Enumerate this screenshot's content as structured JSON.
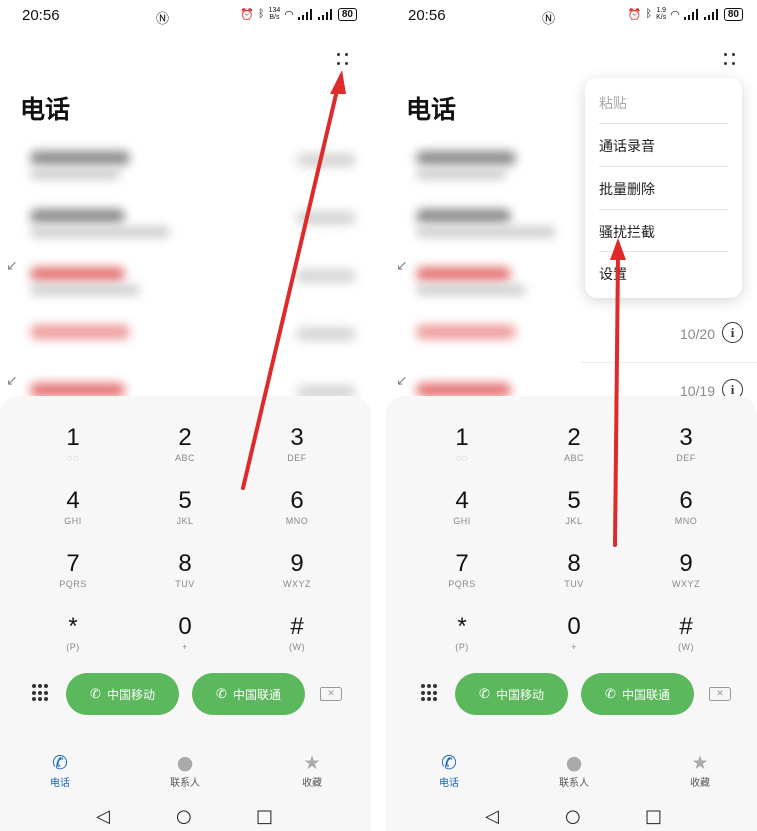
{
  "left": {
    "status": {
      "time": "20:56",
      "net_speed": [
        "134",
        "B/s"
      ],
      "battery": "80"
    },
    "title": "电话",
    "dialpad": {
      "keys": [
        {
          "num": "1",
          "sub": "◌◌"
        },
        {
          "num": "2",
          "sub": "ABC"
        },
        {
          "num": "3",
          "sub": "DEF"
        },
        {
          "num": "4",
          "sub": "GHI"
        },
        {
          "num": "5",
          "sub": "JKL"
        },
        {
          "num": "6",
          "sub": "MNO"
        },
        {
          "num": "7",
          "sub": "PQRS"
        },
        {
          "num": "8",
          "sub": "TUV"
        },
        {
          "num": "9",
          "sub": "WXYZ"
        },
        {
          "num": "*",
          "sub": "(P)"
        },
        {
          "num": "0",
          "sub": "+"
        },
        {
          "num": "#",
          "sub": "(W)"
        }
      ],
      "sim1": "中国移动",
      "sim2": "中国联通"
    },
    "tabs": [
      "电话",
      "联系人",
      "收藏"
    ]
  },
  "right": {
    "status": {
      "time": "20:56",
      "net_speed": [
        "1.9",
        "K/s"
      ],
      "battery": "80"
    },
    "title": "电话",
    "menu": [
      "粘贴",
      "通话录音",
      "批量删除",
      "骚扰拦截",
      "设置"
    ],
    "rows": [
      {
        "date": "10/20"
      },
      {
        "date": "10/19"
      }
    ],
    "dialpad": {
      "keys": [
        {
          "num": "1",
          "sub": "◌◌"
        },
        {
          "num": "2",
          "sub": "ABC"
        },
        {
          "num": "3",
          "sub": "DEF"
        },
        {
          "num": "4",
          "sub": "GHI"
        },
        {
          "num": "5",
          "sub": "JKL"
        },
        {
          "num": "6",
          "sub": "MNO"
        },
        {
          "num": "7",
          "sub": "PQRS"
        },
        {
          "num": "8",
          "sub": "TUV"
        },
        {
          "num": "9",
          "sub": "WXYZ"
        },
        {
          "num": "*",
          "sub": "(P)"
        },
        {
          "num": "0",
          "sub": "+"
        },
        {
          "num": "#",
          "sub": "(W)"
        }
      ],
      "sim1": "中国移动",
      "sim2": "中国联通"
    },
    "tabs": [
      "电话",
      "联系人",
      "收藏"
    ]
  },
  "colors": {
    "call_green": "#5cb85c",
    "active_blue": "#1565c0",
    "arrow_red": "#e02a2a"
  }
}
